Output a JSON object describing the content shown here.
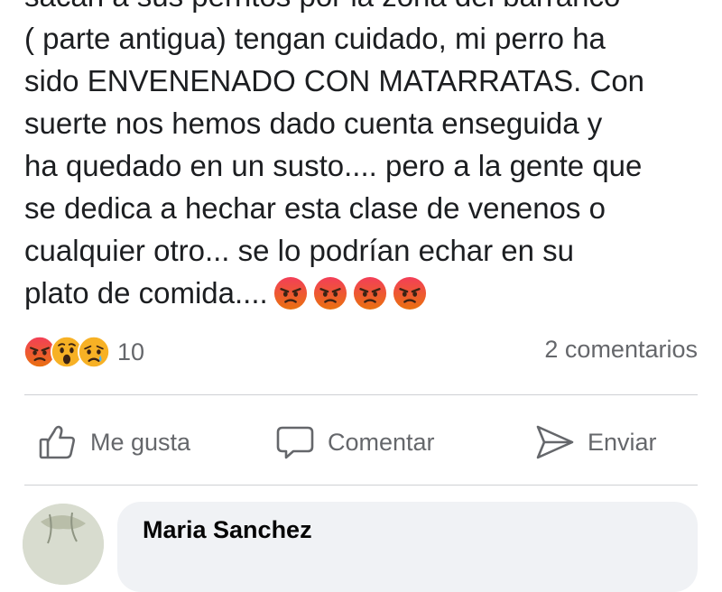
{
  "post": {
    "lines": [
      "sacan a sus perritos por la zona del barranco",
      "( parte antigua) tengan cuidado, mi perro ha",
      "sido ENVENENADO CON MATARRATAS. Con",
      "suerte nos hemos dado cuenta enseguida y",
      "ha quedado en un susto.... pero a la gente que",
      "se dedica a hechar esta clase de venenos o",
      "cualquier otro... se lo podrían echar en su",
      "plato de comida...."
    ],
    "trailing_emoji": [
      "angry-face-icon",
      "angry-face-icon",
      "angry-face-icon",
      "angry-face-icon"
    ]
  },
  "reactions": {
    "icons": [
      "angry-reaction-icon",
      "wow-reaction-icon",
      "sad-reaction-icon"
    ],
    "count": "10",
    "comments_label": "2 comentarios"
  },
  "actions": {
    "like_label": "Me gusta",
    "comment_label": "Comentar",
    "share_label": "Enviar"
  },
  "comment": {
    "author": "Maria Sanchez"
  },
  "colors": {
    "text": "#1c1e21",
    "secondary": "#65676b",
    "divider": "#ced0d4",
    "bubble": "#f0f2f5",
    "angry_top": "#e9710f",
    "angry_bottom": "#f33e58",
    "yellow": "#f7b125"
  }
}
